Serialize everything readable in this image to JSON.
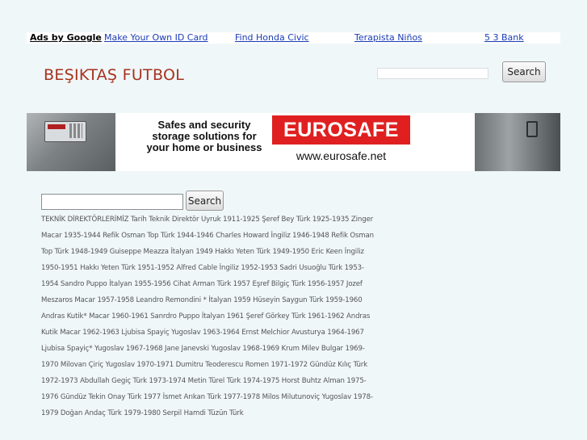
{
  "ad_bar": {
    "label": "Ads by Google",
    "links": [
      "Make Your Own ID Card",
      "Find Honda Civic",
      "Terapista Niños",
      "5 3 Bank"
    ]
  },
  "header": {
    "site_title": "BEŞIKTAŞ FUTBOL",
    "search_button": "Search"
  },
  "banner": {
    "tagline": "Safes and security storage solutions for your home or business",
    "brand": "EUROSAFE",
    "url": "www.eurosafe.net",
    "colors": {
      "brand_bg": "#e02020",
      "brand_text": "#ffffff"
    }
  },
  "main": {
    "search_button": "Search",
    "article_text": "TEKNİK DİREKTÖRLERİMİZ Tarih Teknik Direktör Uyruk 1911-1925 Şeref Bey Türk 1925-1935 Zinger Macar 1935-1944 Refik Osman Top Türk 1944-1946 Charles Howard İngiliz 1946-1948 Refik Osman Top Türk 1948-1949 Guiseppe Meazza İtalyan 1949 Hakkı Yeten Türk 1949-1950 Eric Keen İngiliz 1950-1951 Hakkı Yeten Türk 1951-1952 Alfred Cable İngiliz 1952-1953 Sadri Usuoğlu Türk 1953-1954 Sandro Puppo İtalyan 1955-1956 Cihat Arman Türk 1957 Eşref Bilgiç Türk 1956-1957 Jozef Meszaros Macar 1957-1958 Leandro Remondini * İtalyan 1959 Hüseyin Saygun Türk 1959-1960 Andras Kutik* Macar 1960-1961 Sanrdro Puppo İtalyan 1961 Şeref Görkey Türk 1961-1962 Andras Kutik Macar 1962-1963 Ljubisa Spayiç Yugoslav 1963-1964 Ernst Melchior Avusturya 1964-1967 Ljubisa Spayiç* Yugoslav 1967-1968 Jane Janevski Yugoslav 1968-1969 Krum Milev Bulgar 1969-1970 Milovan Çiriç Yugoslav 1970-1971 Dumitru Teoderescu Romen 1971-1972 Gündüz Kılıç Türk 1972-1973 Abdullah Gegiç Türk 1973-1974 Metin Türel Türk 1974-1975 Horst Buhtz Alman 1975-1976 Gündüz Tekin Onay Türk 1977 İsmet Arıkan Türk 1977-1978 Milos Milutunoviç Yugoslav 1978-1979 Doğan Andaç Türk 1979-1980 Serpil Hamdi Tüzün Türk"
  },
  "colors": {
    "page_bg": "#f0f7f9",
    "title": "#a8321e",
    "link": "#1a3bb5",
    "body_text": "#555555"
  }
}
